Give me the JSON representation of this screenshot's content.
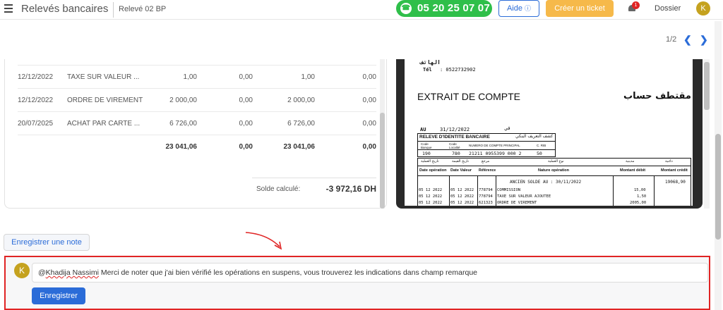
{
  "header": {
    "app_title": "Relevés bancaires",
    "doc_name": "Relevé 02 BP",
    "phone": "05 20 25 07 07",
    "aide_label": "Aide",
    "aide_icon": "help-circle-icon",
    "ticket_label": "Créer un ticket",
    "notif_count": "1",
    "dossier_label": "Dossier",
    "avatar_initial": "K"
  },
  "pager": {
    "text": "1/2"
  },
  "table": {
    "rows": [
      {
        "date": "12/12/2022",
        "libelle": "TAXE SUR VALEUR ...",
        "v1": "1,00",
        "v2": "0,00",
        "v3": "1,00",
        "v4": "0,00"
      },
      {
        "date": "12/12/2022",
        "libelle": "ORDRE DE VIREMENT",
        "v1": "2 000,00",
        "v2": "0,00",
        "v3": "2 000,00",
        "v4": "0,00"
      },
      {
        "date": "20/07/2025",
        "libelle": "ACHAT PAR CARTE ...",
        "v1": "6 726,00",
        "v2": "0,00",
        "v3": "6 726,00",
        "v4": "0,00"
      }
    ],
    "totals": {
      "v1": "23 041,06",
      "v2": "0,00",
      "v3": "23 041,06",
      "v4": "0,00"
    },
    "solde_label": "Solde calculé:",
    "solde_value": "-3 972,16 DH"
  },
  "pdf": {
    "phone_label_ar": "الهاتف",
    "tel_label": "Tél",
    "tel_value": ":  0522732902",
    "title_fr": "EXTRAIT DE COMPTE",
    "title_ar": "مقتطف حساب",
    "au_label": "AU",
    "au_date": "31/12/2022",
    "au_ar": "في",
    "rib_title_fr": "RELEVE D'IDENTITE BANCAIRE",
    "rib_title_ar": "كشف التعريف البنكي",
    "rib_headers": [
      "Code Banque",
      "Code Localité",
      "NUMERO DE COMPTE PRINCIPAL",
      "C. RIB"
    ],
    "rib_values": [
      "190",
      "780",
      "21211 0955399 000 2",
      "50"
    ],
    "col_headers_ar": [
      "تاريخ العملية",
      "تاريخ القيمة",
      "مرجع",
      "نوع العملية",
      "مدينية",
      "دائنية"
    ],
    "col_headers": [
      "Date opération",
      "Date Valeur",
      "Référence",
      "Nature opération",
      "Montant débit",
      "Montant crédit"
    ],
    "ancien_solde": "ANCIEN  SOLDE AU : 30/11/2022",
    "ancien_value": "19068,90",
    "lines": [
      {
        "d1": "05 12 2022",
        "d2": "05 12 2022",
        "ref": "778794",
        "nature": "COMMISSION",
        "debit": "15,00"
      },
      {
        "d1": "05 12 2022",
        "d2": "05 12 2022",
        "ref": "778794",
        "nature": "TAXE SUR VALEUR AJOUTEE",
        "debit": "1,50"
      },
      {
        "d1": "05 12 2022",
        "d2": "05 12 2022",
        "ref": "621323",
        "nature": "ORDRE DE VIREMENT",
        "debit": "2005,00"
      }
    ]
  },
  "note": {
    "button_label": "Enregistrer une note",
    "avatar_initial": "K",
    "mention": "Khadija Nassimi",
    "text_prefix": "@",
    "text_rest": " Merci de noter que j'ai bien vérifié les opérations en suspens, vous trouverez les indications dans champ remarque",
    "save_label": "Enregistrer"
  },
  "colors": {
    "accent": "#2b6cd8",
    "phone": "#2fbf4a",
    "ticket": "#f6b94a",
    "highlight": "#e02424",
    "avatar": "#c5a21f"
  }
}
